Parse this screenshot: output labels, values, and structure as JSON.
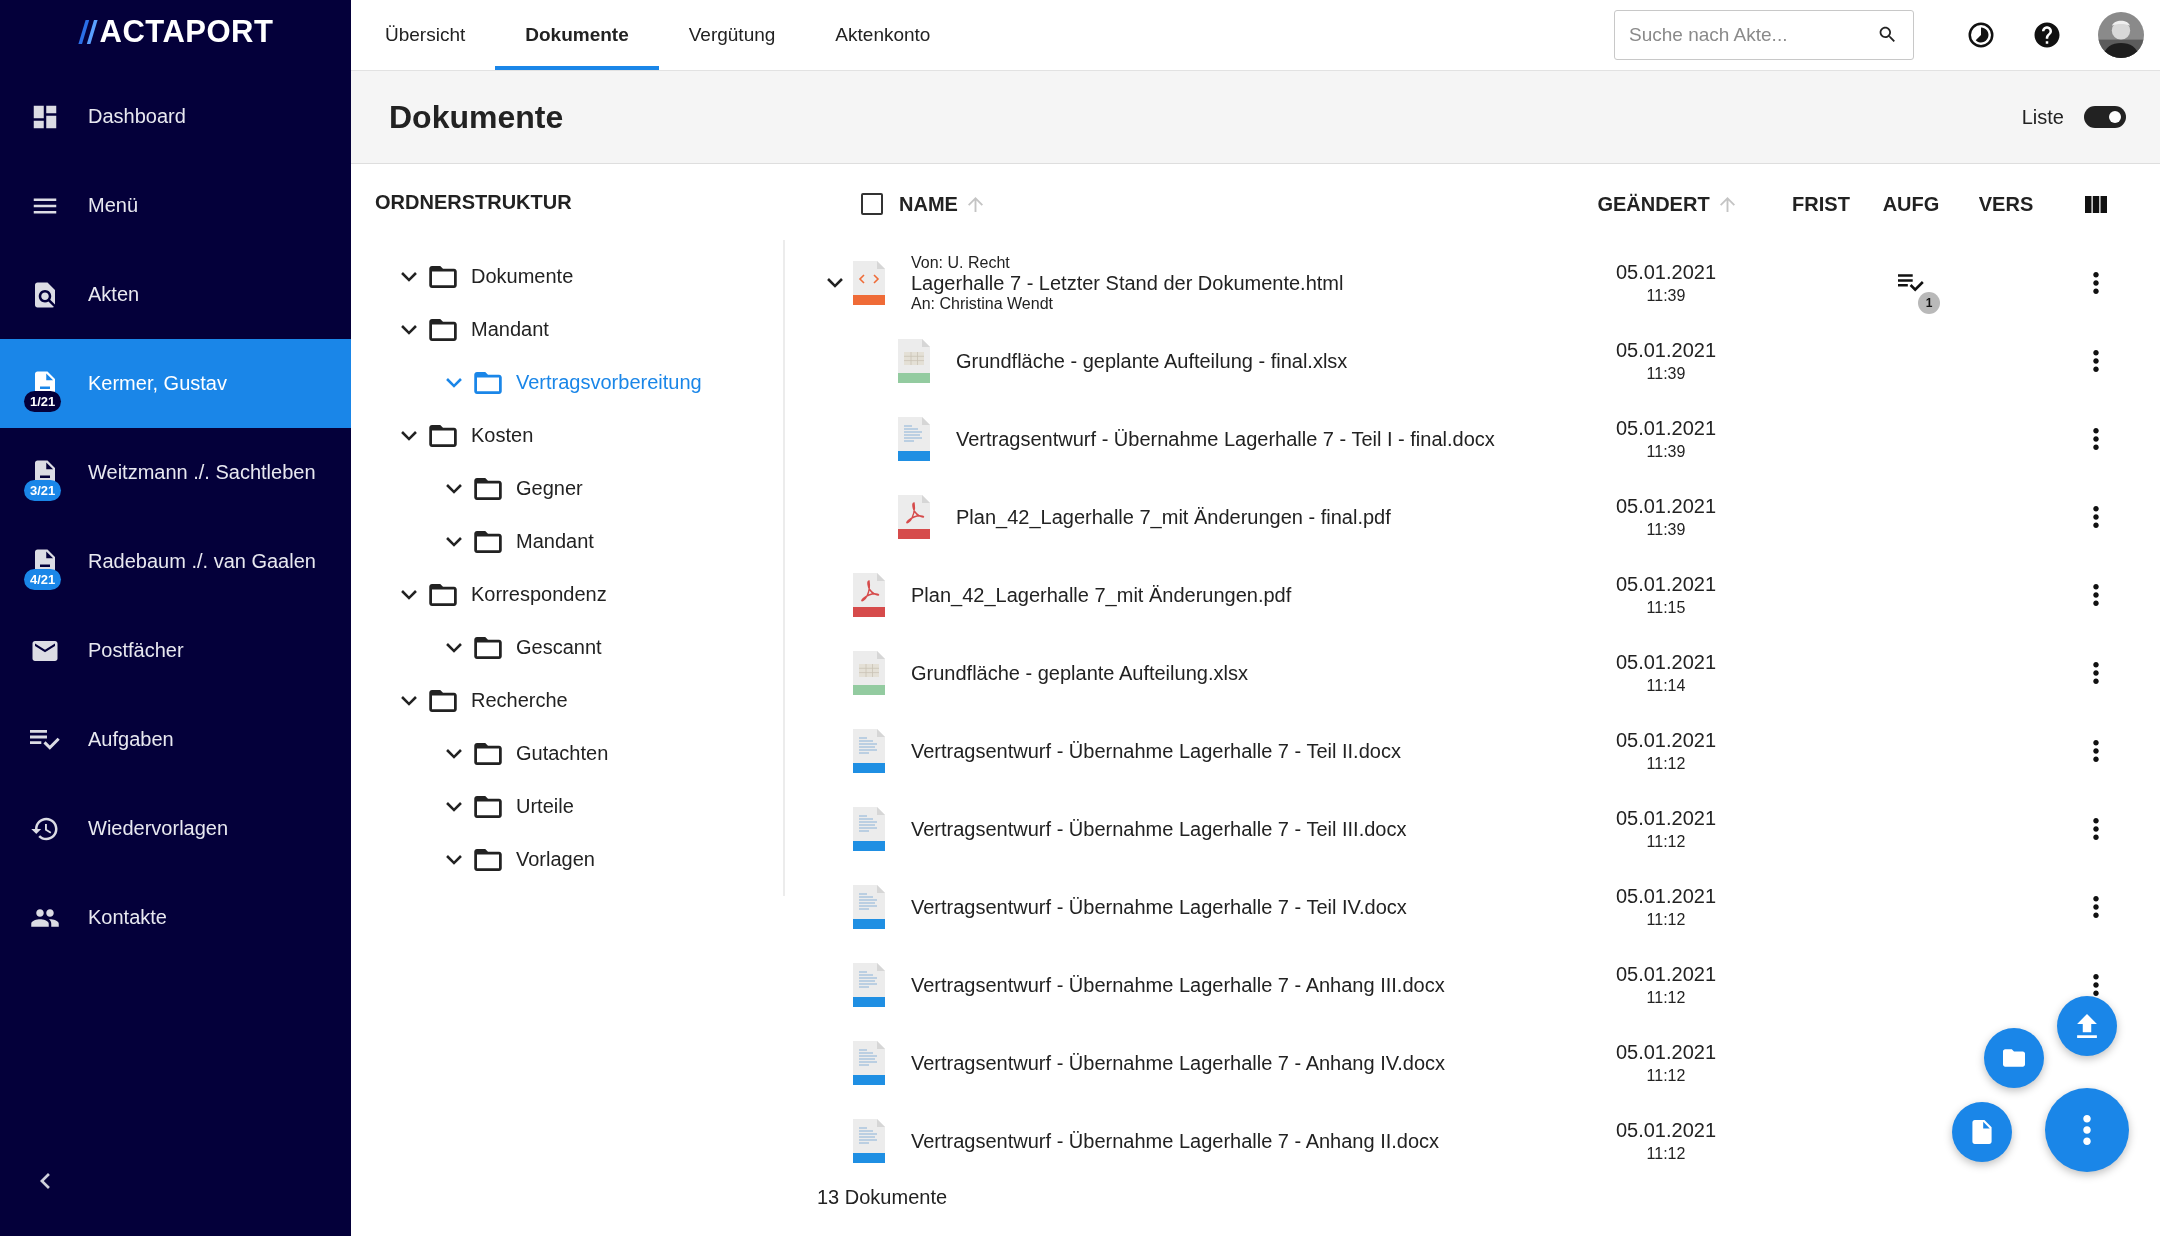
{
  "sidebar": {
    "logo": "ACTAPORT",
    "items": [
      {
        "kind": "page",
        "label": "Dashboard",
        "selected": false
      },
      {
        "kind": "page",
        "label": "Menü",
        "selected": false
      },
      {
        "kind": "page",
        "label": "Akten",
        "selected": false
      },
      {
        "kind": "case",
        "label": "Kermer, Gustav",
        "badge": "1/21",
        "selected": true
      },
      {
        "kind": "case",
        "label": "Weitzmann ./. Sachtleben",
        "badge": "3/21",
        "selected": false
      },
      {
        "kind": "case",
        "label": "Radebaum ./. van Gaalen",
        "badge": "4/21",
        "selected": false
      },
      {
        "kind": "page",
        "label": "Postfächer",
        "selected": false
      },
      {
        "kind": "page",
        "label": "Aufgaben",
        "selected": false
      },
      {
        "kind": "page",
        "label": "Wiedervorlagen",
        "selected": false
      },
      {
        "kind": "page",
        "label": "Kontakte",
        "selected": false
      }
    ]
  },
  "tabs": [
    {
      "label": "Übersicht",
      "selected": false
    },
    {
      "label": "Dokumente",
      "selected": true
    },
    {
      "label": "Vergütung",
      "selected": false
    },
    {
      "label": "Aktenkonto",
      "selected": false
    }
  ],
  "search": {
    "placeholder": "Suche nach Akte..."
  },
  "page_title": "Dokumente",
  "view_toggle": {
    "label": "Liste",
    "on": true
  },
  "folder_tree": {
    "title": "ORDNERSTRUKTUR",
    "items": [
      {
        "name": "Dokumente",
        "expanded": true,
        "selected": false
      },
      {
        "name": "Mandant",
        "expanded": true,
        "selected": false,
        "children": [
          {
            "name": "Vertragsvorbereitung",
            "expanded": true,
            "selected": true
          }
        ]
      },
      {
        "name": "Kosten",
        "expanded": true,
        "selected": false,
        "children": [
          {
            "name": "Gegner",
            "expanded": true,
            "selected": false
          },
          {
            "name": "Mandant",
            "expanded": true,
            "selected": false
          }
        ]
      },
      {
        "name": "Korrespondenz",
        "expanded": true,
        "selected": false,
        "children": [
          {
            "name": "Gescannt",
            "expanded": true,
            "selected": false
          }
        ]
      },
      {
        "name": "Recherche",
        "expanded": true,
        "selected": false,
        "children": [
          {
            "name": "Gutachten",
            "expanded": true,
            "selected": false
          },
          {
            "name": "Urteile",
            "expanded": true,
            "selected": false
          },
          {
            "name": "Vorlagen",
            "expanded": true,
            "selected": false
          }
        ]
      }
    ]
  },
  "table": {
    "select_all": {
      "checked": false
    },
    "columns": [
      {
        "label": "NAME",
        "sortable": true
      },
      {
        "label": "GEÄNDERT",
        "sortable": true
      },
      {
        "label": "FRIST",
        "sortable": false
      },
      {
        "label": "AUFG",
        "sortable": false
      },
      {
        "label": "VERS",
        "sortable": false
      }
    ],
    "rows": [
      {
        "kind": "html",
        "from": "Von: U. Recht",
        "name": "Lagerhalle 7 - Letzter Stand der Dokumente.html",
        "to": "An: Christina Wendt",
        "date": "05.01.2021",
        "time": "11:39",
        "tasks": "1",
        "expanded": true,
        "children": [
          {
            "kind": "spreadsheet",
            "name": "Grundfläche - geplante Aufteilung - final.xlsx",
            "date": "05.01.2021",
            "time": "11:39"
          },
          {
            "kind": "document",
            "name": "Vertragsentwurf - Übernahme Lagerhalle 7 - Teil I - final.docx",
            "date": "05.01.2021",
            "time": "11:39"
          },
          {
            "kind": "pdf",
            "name": "Plan_42_Lagerhalle 7_mit Änderungen - final.pdf",
            "date": "05.01.2021",
            "time": "11:39"
          }
        ]
      },
      {
        "kind": "pdf",
        "name": "Plan_42_Lagerhalle 7_mit Änderungen.pdf",
        "date": "05.01.2021",
        "time": "11:15"
      },
      {
        "kind": "spreadsheet",
        "name": "Grundfläche - geplante Aufteilung.xlsx",
        "date": "05.01.2021",
        "time": "11:14"
      },
      {
        "kind": "document",
        "name": "Vertragsentwurf - Übernahme Lagerhalle 7 - Teil II.docx",
        "date": "05.01.2021",
        "time": "11:12"
      },
      {
        "kind": "document",
        "name": "Vertragsentwurf - Übernahme Lagerhalle 7 - Teil III.docx",
        "date": "05.01.2021",
        "time": "11:12"
      },
      {
        "kind": "document",
        "name": "Vertragsentwurf - Übernahme Lagerhalle 7 - Teil IV.docx",
        "date": "05.01.2021",
        "time": "11:12"
      },
      {
        "kind": "document",
        "name": "Vertragsentwurf - Übernahme Lagerhalle 7 - Anhang III.docx",
        "date": "05.01.2021",
        "time": "11:12"
      },
      {
        "kind": "document",
        "name": "Vertragsentwurf - Übernahme Lagerhalle 7 - Anhang IV.docx",
        "date": "05.01.2021",
        "time": "11:12"
      },
      {
        "kind": "document",
        "name": "Vertragsentwurf - Übernahme Lagerhalle 7 - Anhang II.docx",
        "date": "05.01.2021",
        "time": "11:12"
      }
    ],
    "footer": "13 Dokumente"
  },
  "fabs": [
    {
      "kind": "upload"
    },
    {
      "kind": "folder"
    },
    {
      "kind": "file"
    },
    {
      "kind": "more"
    }
  ]
}
